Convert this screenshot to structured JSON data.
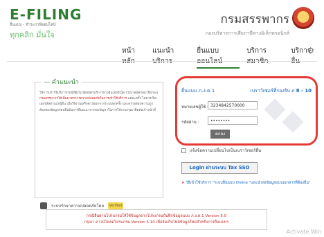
{
  "header": {
    "logo_title": "E-FILING",
    "logo_sub": "ยื่นแบบ - ชำระภาษีออนไลน์",
    "logo_tagline": "ทุกคลิก มั่นใจ",
    "dept_name": "กรมสรรพากร",
    "dept_sub": "กองบริหารการเสียภาษีทางอิเล็กทรอนิกส์"
  },
  "nav": {
    "items": [
      "หน้าหลัก",
      "แนะนำบริการ",
      "ยื่นแบบออนไลน์",
      "บริการสมาชิก",
      "บริการอื่น"
    ],
    "active_index": 2,
    "settings_icon": "gear-icon"
  },
  "advice": {
    "title": "คำแนะนำ",
    "text_1": "วิธีการเข้าใช้บริการกรณีที่ยังไม่ได้สมัครบริการทางอินเทอร์เน็ต กรุณาสมัครสมาชิกก่อน",
    "text_red": "กรมสรรพากรได้เพิ่มมาตรการความปลอดภัยในการเข้าใช้บริการ",
    "text_2": "แต่ละครั้ง ไม่ควรเปิดเผยรหัสผ่านแก่ผู้อื่น เมื่อใช้งานเสร็จควรออกจากระบบทุกครั้ง และตรวจสอบความถูกต้องของข้อมูลก่อนยืนยันการยื่นแบบ หากพบปัญหาในการใช้งานกรุณาติดต่อเจ้าหน้าที่",
    "footer": "ระบบรักษาความปลอดภัยโดย",
    "cert_label": "Verified"
  },
  "login": {
    "title": "ยื่นแบบ ภ.ง.ด.1",
    "version_label": "เบราว์เซอร์ที่รองรับ",
    "version_numbers": "8 - 10",
    "id_label": "หมายเลขผู้ใช้ :",
    "id_value": "3234842570000",
    "pw_label": "รหัสผ่าน :",
    "pw_value": "••••••••",
    "submit_label": "ตกลง"
  },
  "checkbox_label": "แจ้งข้อความเปลี่ยนไปเป็นเบราว์เซอร์อื่น",
  "sso_button": "Login ผ่านระบบ Tax SSO",
  "note": "วิธีเข้าใช้บริการ \"ระบบยื่นแบบ Online \"และนำส่งข้อมูลแบบเอกสารที่ต้องยื่น\"",
  "notice": {
    "line1": "กรณียื่นผ่านโปรแกรมให้ใช้ข้อมูลจากโปรแกรมบันทึกข้อมูลแบบ ภ.ง.ด.1 Version 5.0",
    "line2": "กรุณา ดาวน์โหลดโปรแกรม Version 5.10 เพื่อจัดเก็บไฟล์ข้อมูลใหม่สำหรับการยื่นแบบฯ"
  },
  "watermark": "Activate Win"
}
